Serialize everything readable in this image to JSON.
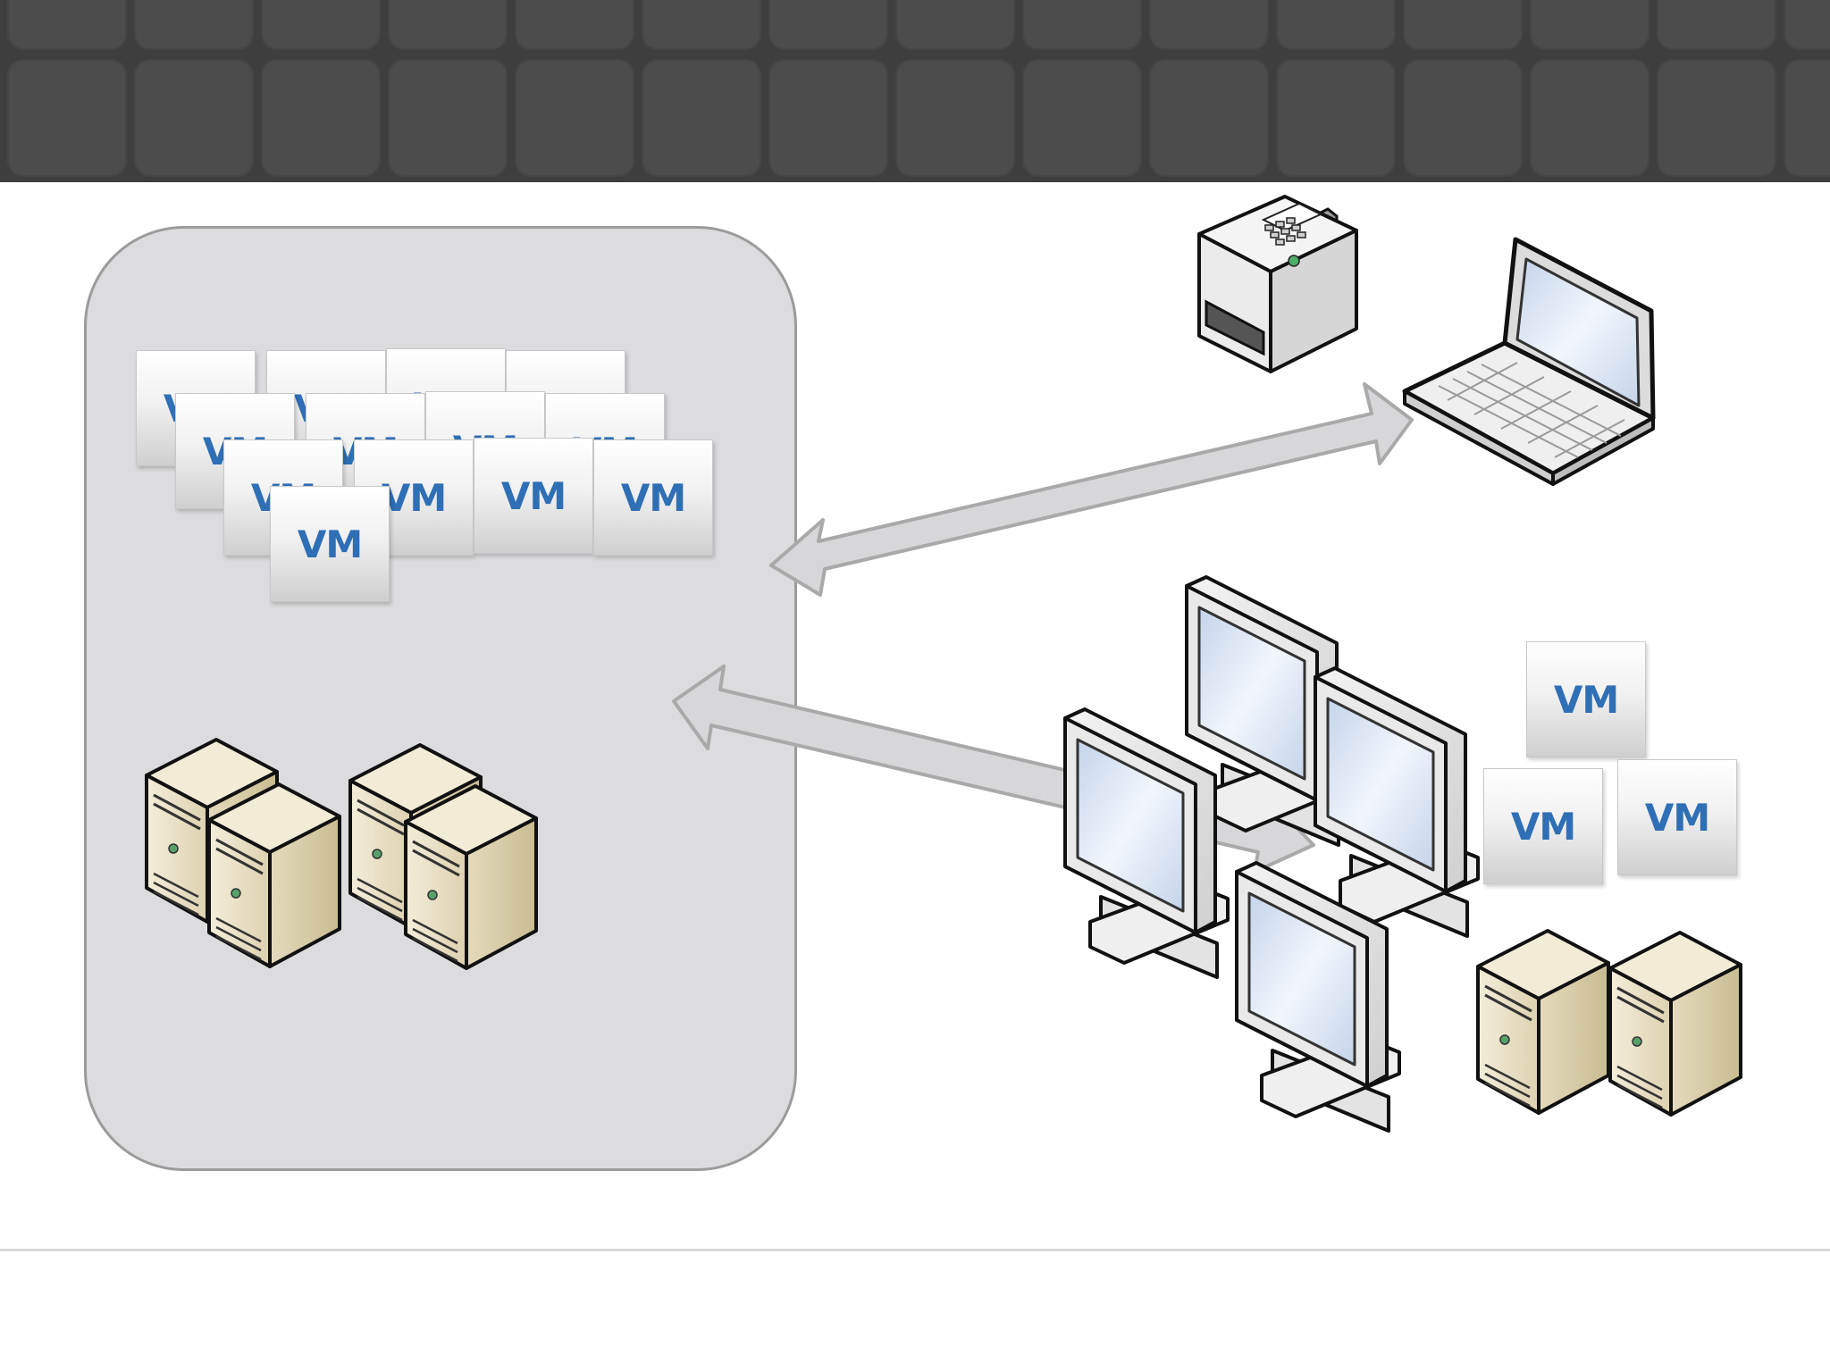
{
  "vm_label": "VM",
  "colors": {
    "header_bg": "#3e3e3e",
    "tile": "#4c4c4c",
    "container_fill": "#dcdcde",
    "container_border": "#9b9b9b",
    "arrow_fill": "#d7d7d9",
    "arrow_stroke": "#a9a9a9",
    "vm_text": "#2f6fb5",
    "server_body": "#e9e1c6",
    "monitor_screen": "#dbe6f4"
  },
  "icons": [
    "printer-icon",
    "laptop-icon",
    "monitor-icon",
    "server-tower-icon",
    "double-arrow-icon"
  ]
}
